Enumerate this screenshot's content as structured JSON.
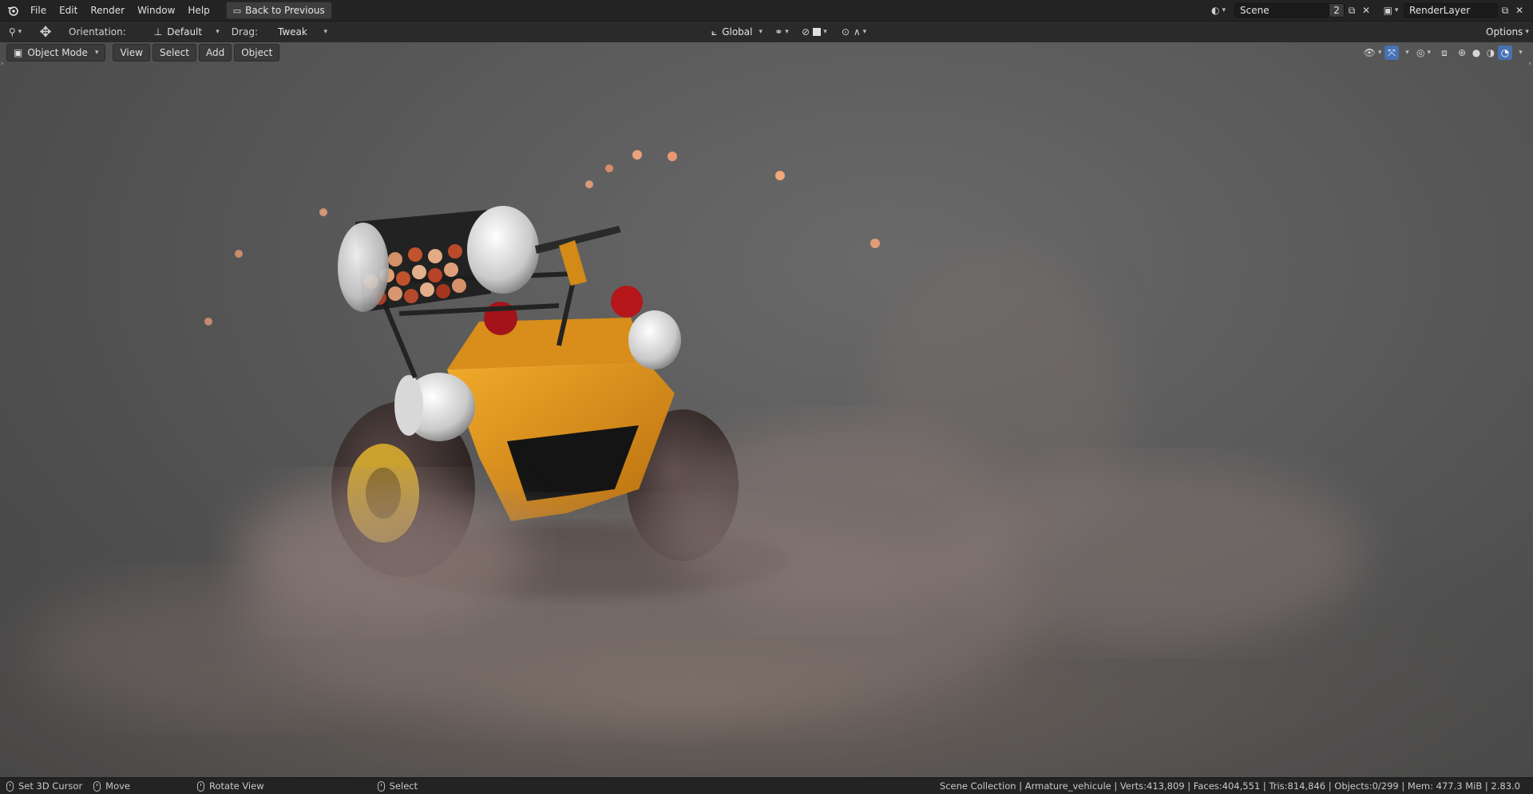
{
  "topbar": {
    "menus": [
      "File",
      "Edit",
      "Render",
      "Window",
      "Help"
    ],
    "back_button": "Back to Previous",
    "scene": "Scene",
    "scene_users": "2",
    "render_layer": "RenderLayer"
  },
  "toolbar": {
    "orientation_label": "Orientation:",
    "orientation_value": "Default",
    "drag_label": "Drag:",
    "drag_value": "Tweak",
    "transform_orientation": "Global",
    "options": "Options"
  },
  "viewport_header": {
    "mode": "Object Mode",
    "menus": [
      "View",
      "Select",
      "Add",
      "Object"
    ]
  },
  "statusbar": {
    "hints": [
      "Set 3D Cursor",
      "Move",
      "Rotate View",
      "Select"
    ],
    "stats": "Scene Collection | Armature_vehicule | Verts:413,809 | Faces:404,551 | Tris:814,846 | Objects:0/299 | Mem: 477.3 MiB | 2.83.0"
  },
  "colors": {
    "accent": "#4772b3",
    "vehicle": "#e59a1f",
    "bg": "#232323"
  },
  "icons": [
    "blender-logo-icon",
    "back-icon",
    "move-tool-icon",
    "orientation-icon",
    "global-axes-icon",
    "pivot-icon",
    "snap-icon",
    "proportional-icon",
    "falloff-icon",
    "object-mode-icon",
    "visibility-icon",
    "gizmo-icon",
    "overlay-icon",
    "xray-icon",
    "wireframe-shading-icon",
    "solid-shading-icon",
    "material-shading-icon",
    "rendered-shading-icon",
    "mouse-icon"
  ]
}
